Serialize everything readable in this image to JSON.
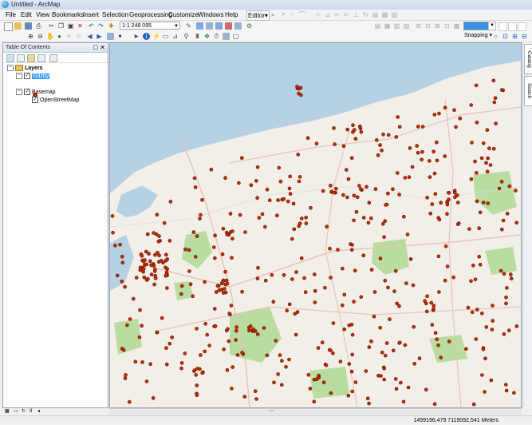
{
  "window": {
    "title": "Untitled - ArcMap"
  },
  "menu": [
    "File",
    "Edit",
    "View",
    "Bookmarks",
    "Insert",
    "Selection",
    "Geoprocessing",
    "Customize",
    "Windows",
    "Help"
  ],
  "editor_label": "Editor▾",
  "scale": {
    "value": "1:1 248 095"
  },
  "snapping_label": "Snapping ▾",
  "toc": {
    "title": "Table Of Contents",
    "layers_label": "Layers",
    "layer1": "Gdzby",
    "basemap": "Basemap",
    "osm": "OpenStreetMap"
  },
  "right_tabs": [
    "Catalog",
    "Search"
  ],
  "status": {
    "coords": "1499196,479  7119092,541 Meters"
  },
  "colors": {
    "sea": "#b6d0e4",
    "land": "#f1efe8",
    "forest": "#b9dca0",
    "point": "#c62b00",
    "road": "#e9c3b8"
  }
}
